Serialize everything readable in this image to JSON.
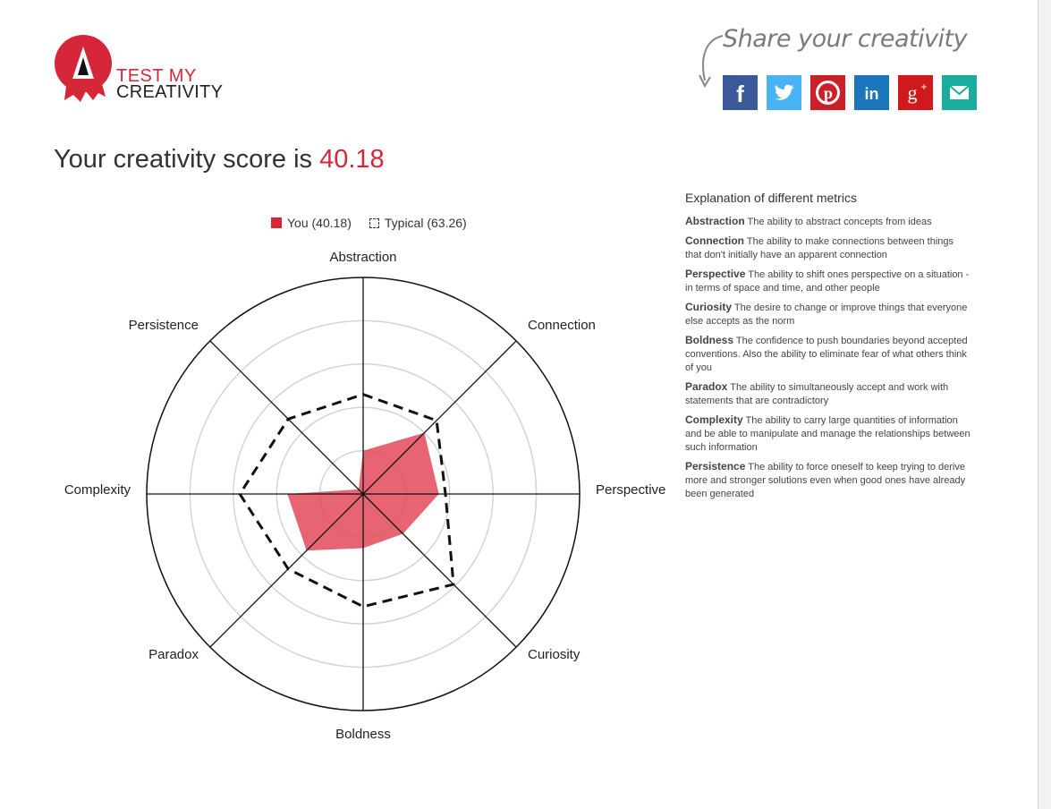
{
  "logo": {
    "letter": "A",
    "line1": "TEST MY",
    "line2": "CREATIVITY"
  },
  "share": {
    "title": "Share your creativity",
    "buttons": [
      {
        "name": "facebook",
        "icon": "facebook-icon",
        "color": "#3b5998"
      },
      {
        "name": "twitter",
        "icon": "twitter-icon",
        "color": "#4ab3f4"
      },
      {
        "name": "pinterest",
        "icon": "pinterest-icon",
        "color": "#cb2027"
      },
      {
        "name": "linkedin",
        "icon": "linkedin-icon",
        "color": "#1b75bc"
      },
      {
        "name": "google-plus",
        "icon": "google-plus-icon",
        "color": "#d0191d"
      },
      {
        "name": "email",
        "icon": "email-icon",
        "color": "#1aac9e"
      }
    ]
  },
  "score": {
    "prefix": "Your creativity score is ",
    "value": "40.18"
  },
  "colors": {
    "accent": "#d6273a",
    "fill": "#e34a5b"
  },
  "chart_data": {
    "type": "radar",
    "legend": [
      {
        "label": "You (40.18)",
        "style": "filled red"
      },
      {
        "label": "Typical (63.26)",
        "style": "dashed outline"
      }
    ],
    "axes": [
      "Abstraction",
      "Connection",
      "Perspective",
      "Curiosity",
      "Boldness",
      "Paradox",
      "Complexity",
      "Persistence"
    ],
    "range": [
      0,
      100
    ],
    "rings": 5,
    "series": [
      {
        "name": "You (40.18)",
        "values": [
          20,
          40,
          35,
          26,
          25,
          37,
          35,
          3
        ]
      },
      {
        "name": "Typical (63.26)",
        "values": [
          46,
          48,
          38,
          59,
          52,
          49,
          57,
          49
        ]
      }
    ]
  },
  "explanation": {
    "title": "Explanation of different metrics",
    "items": [
      {
        "name": "Abstraction",
        "text": "The ability to abstract concepts from ideas"
      },
      {
        "name": "Connection",
        "text": "The ability to make connections between things that don't initially have an apparent connection"
      },
      {
        "name": "Perspective",
        "text": "The ability to shift ones perspective on a situation - in terms of space and time, and other people"
      },
      {
        "name": "Curiosity",
        "text": "The desire to change or improve things that everyone else accepts as the norm"
      },
      {
        "name": "Boldness",
        "text": "The confidence to push boundaries beyond accepted conventions. Also the ability to eliminate fear of what others think of you"
      },
      {
        "name": "Paradox",
        "text": "The ability to simultaneously accept and work with statements that are contradictory"
      },
      {
        "name": "Complexity",
        "text": "The ability to carry large quantities of information and be able to manipulate and manage the relationships between such information"
      },
      {
        "name": "Persistence",
        "text": "The ability to force oneself to keep trying to derive more and stronger solutions even when good ones have already been generated"
      }
    ]
  }
}
